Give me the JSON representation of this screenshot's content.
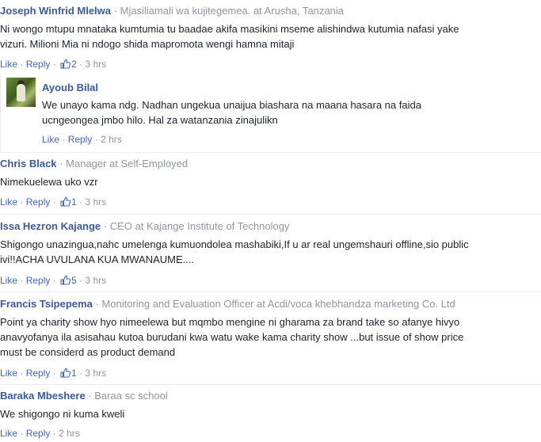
{
  "comments": [
    {
      "name": "Joseph Winfrid Mlelwa",
      "subtitle": "Mjasiliamali wa kujitegemea. at Arusha, Tanzania",
      "text_lines": [
        "Ni wongo mtupu mnataka kumtumia tu baadae akifa masikini mseme alishindwa kutumia nafasi yake",
        "vizuri. Milioni Mia ni ndogo shida mapromota wengi hamna mitaji"
      ],
      "like": "Like",
      "reply": "Reply",
      "likes": "2",
      "time": "3 hrs"
    },
    {
      "name": "Chris Black",
      "subtitle": "Manager at Self-Employed",
      "text_lines": [
        "Nimekuelewa uko vzr"
      ],
      "like": "Like",
      "reply": "Reply",
      "likes": "1",
      "time": "3 hrs"
    },
    {
      "name": "Issa Hezron Kajange",
      "subtitle": "CEO at Kajange Institute of Technology",
      "text_lines": [
        "Shigongo unazingua,nahc umelenga kumuondolea mashabiki,If u ar real ungemshauri offline,sio public",
        "ivi!!ACHA UVULANA KUA MWANAUME...."
      ],
      "like": "Like",
      "reply": "Reply",
      "likes": "5",
      "time": "3 hrs"
    },
    {
      "name": "Francis Tsipepema",
      "subtitle": "Monitoring and Evaluation Officer at Acdi/voca khebhandza marketing Co. Ltd",
      "text_lines": [
        "Point ya charity show hyo nimeelewa but mqmbo mengine ni gharama za brand take so afanye hivyo",
        "anavyofanya ila asisahau kutoa burudani kwa watu wake kama charity show ...but issue of show price",
        "must be considerd as product demand"
      ],
      "like": "Like",
      "reply": "Reply",
      "likes": "1",
      "time": "3 hrs"
    },
    {
      "name": "Baraka Mbeshere",
      "subtitle": "Baraa sc school",
      "text_lines": [
        "We shigongo ni kuma kweli"
      ],
      "like": "Like",
      "reply": "Reply",
      "likes": "",
      "time": "2 hrs"
    }
  ],
  "reply": {
    "name": "Ayoub Bilal",
    "text_lines": [
      "We unayo kama ndg. Nadhan ungekua unaijua biashara na maana hasara na faida",
      "ucngeongea jmbo hilo. Hal za watanzania zinajulikn"
    ],
    "like": "Like",
    "reply": "Reply",
    "time": "2 hrs"
  },
  "separator": "·",
  "colors": {
    "name": "#3b5998",
    "link": "#4267b2",
    "meta": "#90949c",
    "text": "#1d2129"
  },
  "icons": {
    "like_count": "thumbs-up-icon"
  }
}
